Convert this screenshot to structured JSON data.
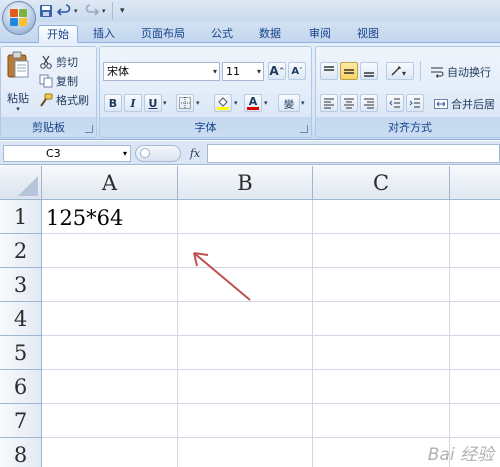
{
  "quick_access": {
    "save_icon": "save-icon",
    "undo_icon": "undo-icon",
    "redo_icon": "redo-icon",
    "customize_label": "▾"
  },
  "tabs": [
    {
      "label": "开始",
      "active": true
    },
    {
      "label": "插入"
    },
    {
      "label": "页面布局"
    },
    {
      "label": "公式"
    },
    {
      "label": "数据"
    },
    {
      "label": "审阅"
    },
    {
      "label": "视图"
    }
  ],
  "clipboard": {
    "paste_label": "粘贴",
    "cut_label": "剪切",
    "copy_label": "复制",
    "format_painter_label": "格式刷",
    "group_label": "剪贴板"
  },
  "font": {
    "font_name": "宋体",
    "font_size": "11",
    "grow_label": "A",
    "shrink_label": "A",
    "bold_label": "B",
    "italic_label": "I",
    "underline_label": "U",
    "font_color_label": "A",
    "phonetic_label": "變",
    "group_label": "字体"
  },
  "alignment": {
    "wrap_text_label": "自动换行",
    "merge_center_label": "合并后居",
    "group_label": "对齐方式"
  },
  "formula_bar": {
    "name_box": "C3",
    "fx_label": "fx",
    "formula": ""
  },
  "grid": {
    "columns": [
      "A",
      "B",
      "C"
    ],
    "rows": [
      "1",
      "2",
      "3",
      "4",
      "5",
      "6",
      "7",
      "8"
    ],
    "cell_a1": "125*64",
    "selected_cell": "C3"
  },
  "watermark": "Bai 经验",
  "colors": {
    "ribbon_bg": "#dbe7f6",
    "tab_text": "#15428b",
    "annotation_arrow": "#c0504d",
    "grid_line": "#d0d7e5"
  }
}
